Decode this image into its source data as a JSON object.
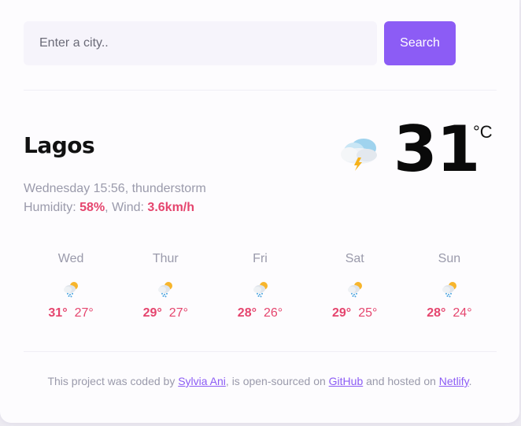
{
  "search": {
    "placeholder": "Enter a city..",
    "button_label": "Search"
  },
  "current": {
    "city": "Lagos",
    "datetime": "Wednesday 15:56",
    "description": "thunderstorm",
    "humidity_label": "Humidity:",
    "humidity_value": "58%",
    "wind_label": "Wind:",
    "wind_value": "3.6km/h",
    "temperature": "31",
    "unit": "°C",
    "icon": "thunderstorm-cloud-icon"
  },
  "forecast": [
    {
      "day": "Wed",
      "max": "31°",
      "min": "27°",
      "icon": "sun-rain-cloud-icon"
    },
    {
      "day": "Thur",
      "max": "29°",
      "min": "27°",
      "icon": "sun-rain-cloud-icon"
    },
    {
      "day": "Fri",
      "max": "28°",
      "min": "26°",
      "icon": "sun-rain-cloud-icon"
    },
    {
      "day": "Sat",
      "max": "29°",
      "min": "25°",
      "icon": "sun-rain-cloud-icon"
    },
    {
      "day": "Sun",
      "max": "28°",
      "min": "24°",
      "icon": "sun-rain-cloud-icon"
    }
  ],
  "footer": {
    "text_1": "This project was coded by",
    "author_link": "Sylvia Ani",
    "text_2": ", is open-sourced on",
    "github_link": "GitHub",
    "text_3": "and hosted on",
    "netlify_link": "Netlify",
    "text_4": "."
  },
  "colors": {
    "accent": "#8c5cf5",
    "highlight": "#e5456e",
    "muted": "#9a9aab"
  }
}
